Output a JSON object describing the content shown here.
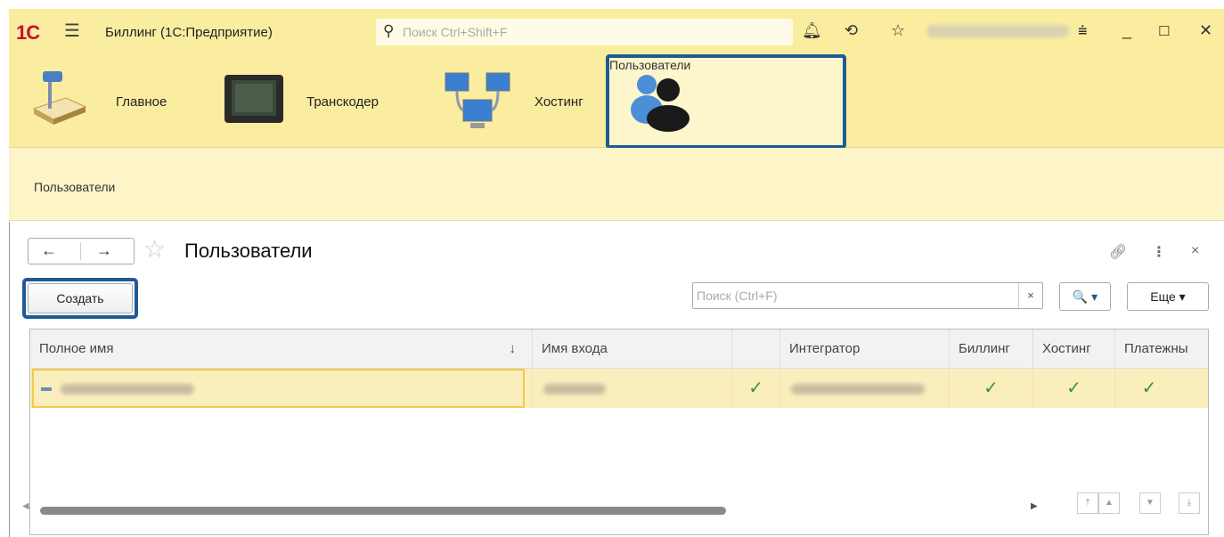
{
  "titlebar": {
    "logo": "1С",
    "menu_icon": "hamburger-icon",
    "title": "Биллинг  (1С:Предприятие)",
    "search_placeholder": "Поиск Ctrl+Shift+F",
    "icons": [
      "bell-icon",
      "history-icon",
      "star-icon"
    ],
    "window_icons": [
      "filter-icon",
      "minimize-icon",
      "maximize-icon",
      "close-icon"
    ]
  },
  "sections": [
    {
      "label": "Главное",
      "icon": "desk-lamp-icon"
    },
    {
      "label": "Транскодер",
      "icon": "monitor-icon"
    },
    {
      "label": "Хостинг",
      "icon": "network-computers-icon"
    },
    {
      "label": "Пользователи",
      "icon": "users-icon",
      "active": true
    }
  ],
  "nav_panel": {
    "items": [
      "Пользователи"
    ]
  },
  "form": {
    "title": "Пользователи",
    "back": "←",
    "forward": "→",
    "create_label": "Создать",
    "search_placeholder": "Поиск (Ctrl+F)",
    "search_clear": "×",
    "search_button": "🔍 ▾",
    "more_label": "Еще ▾",
    "link_icon": "link-icon",
    "menu_icon": "kebab-icon",
    "close_icon": "close-icon"
  },
  "table": {
    "columns": [
      "Полное имя",
      "Имя входа",
      "",
      "Интегратор",
      "Биллинг",
      "Хостинг",
      "Платежны"
    ],
    "sort_indicator": "↓",
    "rows": [
      {
        "check": "✓",
        "billing": "✓",
        "hosting": "✓",
        "payments": "✓"
      }
    ]
  },
  "colors": {
    "yellow_panel": "#fbeda0",
    "highlight_border": "#1d5b94",
    "check": "#2e9a2e"
  }
}
